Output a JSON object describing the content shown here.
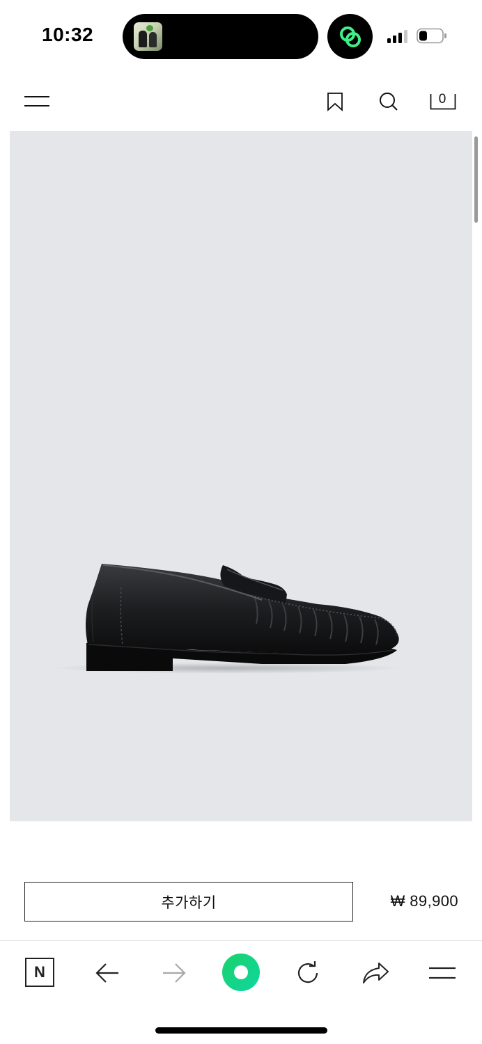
{
  "status_bar": {
    "time": "10:32",
    "icons": [
      "island-thumbnail",
      "app-link-icon",
      "signal-icon",
      "battery-icon"
    ]
  },
  "header": {
    "icons": [
      "menu-icon",
      "bookmark-icon",
      "search-icon",
      "bag-icon"
    ],
    "cart_count": "0"
  },
  "product": {
    "image": "black-penny-loafer",
    "add_button_label": "추가하기",
    "price": "₩ 89,900"
  },
  "browser_toolbar": {
    "n_button_label": "N",
    "icons": [
      "back-arrow-icon",
      "forward-arrow-icon",
      "home-circle-icon",
      "reload-icon",
      "share-icon",
      "menu-icon"
    ],
    "accent_color": "#19d26a"
  }
}
